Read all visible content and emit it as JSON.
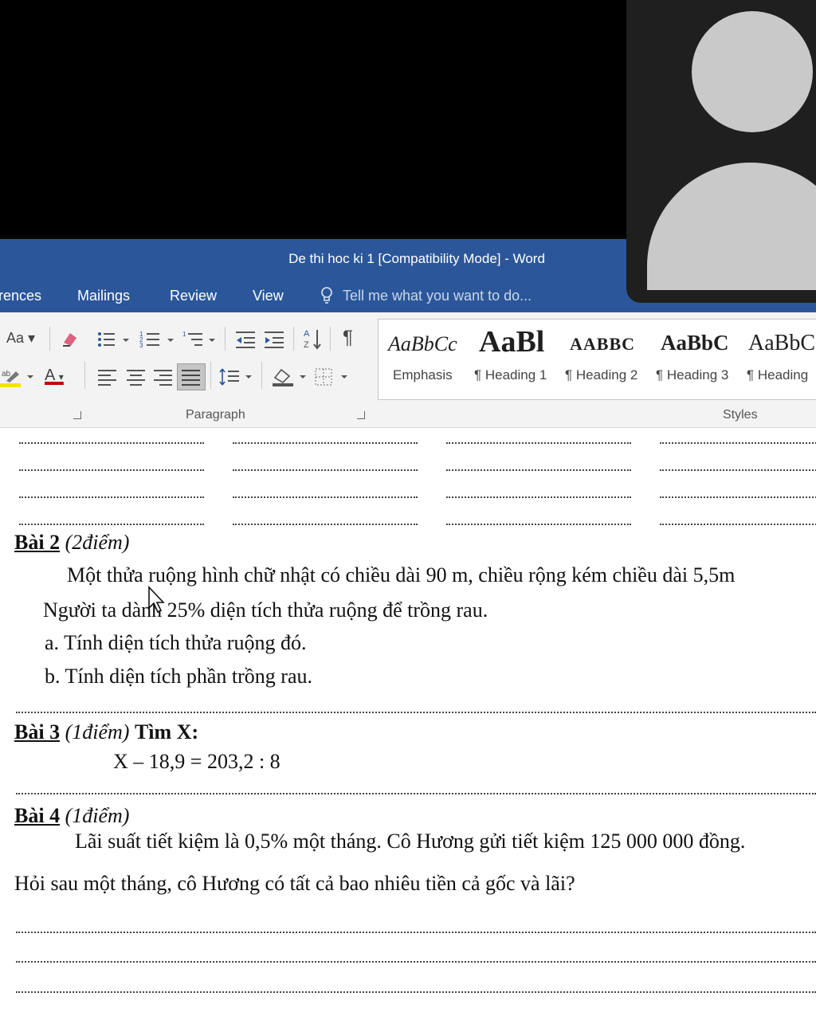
{
  "window": {
    "title": "De thi hoc ki 1 [Compatibility Mode] - Word"
  },
  "tabs": [
    {
      "label": "rences"
    },
    {
      "label": "Mailings"
    },
    {
      "label": "Review"
    },
    {
      "label": "View"
    }
  ],
  "tell_me": {
    "placeholder": "Tell me what you want to do..."
  },
  "ribbon": {
    "font_case_label": "Aa",
    "paragraph_label": "Paragraph",
    "styles_label": "Styles",
    "styles": [
      {
        "sample": "AaBbCc",
        "name": "Emphasis"
      },
      {
        "sample": "AaBl",
        "name": "¶ Heading 1"
      },
      {
        "sample": "AABBC",
        "name": "¶ Heading 2"
      },
      {
        "sample": "AaBbC",
        "name": "¶ Heading 3"
      },
      {
        "sample": "AaBbC",
        "name": "¶ Heading"
      }
    ]
  },
  "document": {
    "bai2": {
      "title": "Bài 2",
      "points": "(2điểm)",
      "line1": "Một thửa ruộng  hình chữ nhật có chiều dài 90 m, chiều rộng kém chiều dài 5,5m",
      "line2": "Người ta dành 25% diện tích thửa ruộng để trồng rau.",
      "item_a": "a.  Tính diện tích thửa ruộng đó.",
      "item_b": "b.  Tính diện tích  phần  trồng rau."
    },
    "bai3": {
      "title": "Bài 3",
      "points": "(1điểm)",
      "task": "Tìm X:",
      "equation": "X – 18,9 = 203,2 : 8"
    },
    "bai4": {
      "title": "Bài 4",
      "points": "(1điểm)",
      "line1": "Lãi suất tiết kiệm là 0,5% một tháng. Cô Hương gửi tiết kiệm 125 000 000 đồng.",
      "line2": "Hỏi sau  một  tháng, cô Hương có tất cả bao nhiêu tiền cả gốc và lãi?"
    }
  },
  "colors": {
    "title_bar": "#2b579a",
    "ribbon_bg": "#f3f3f3",
    "video_bg": "#000000",
    "avatar": "#c9c9c9"
  }
}
